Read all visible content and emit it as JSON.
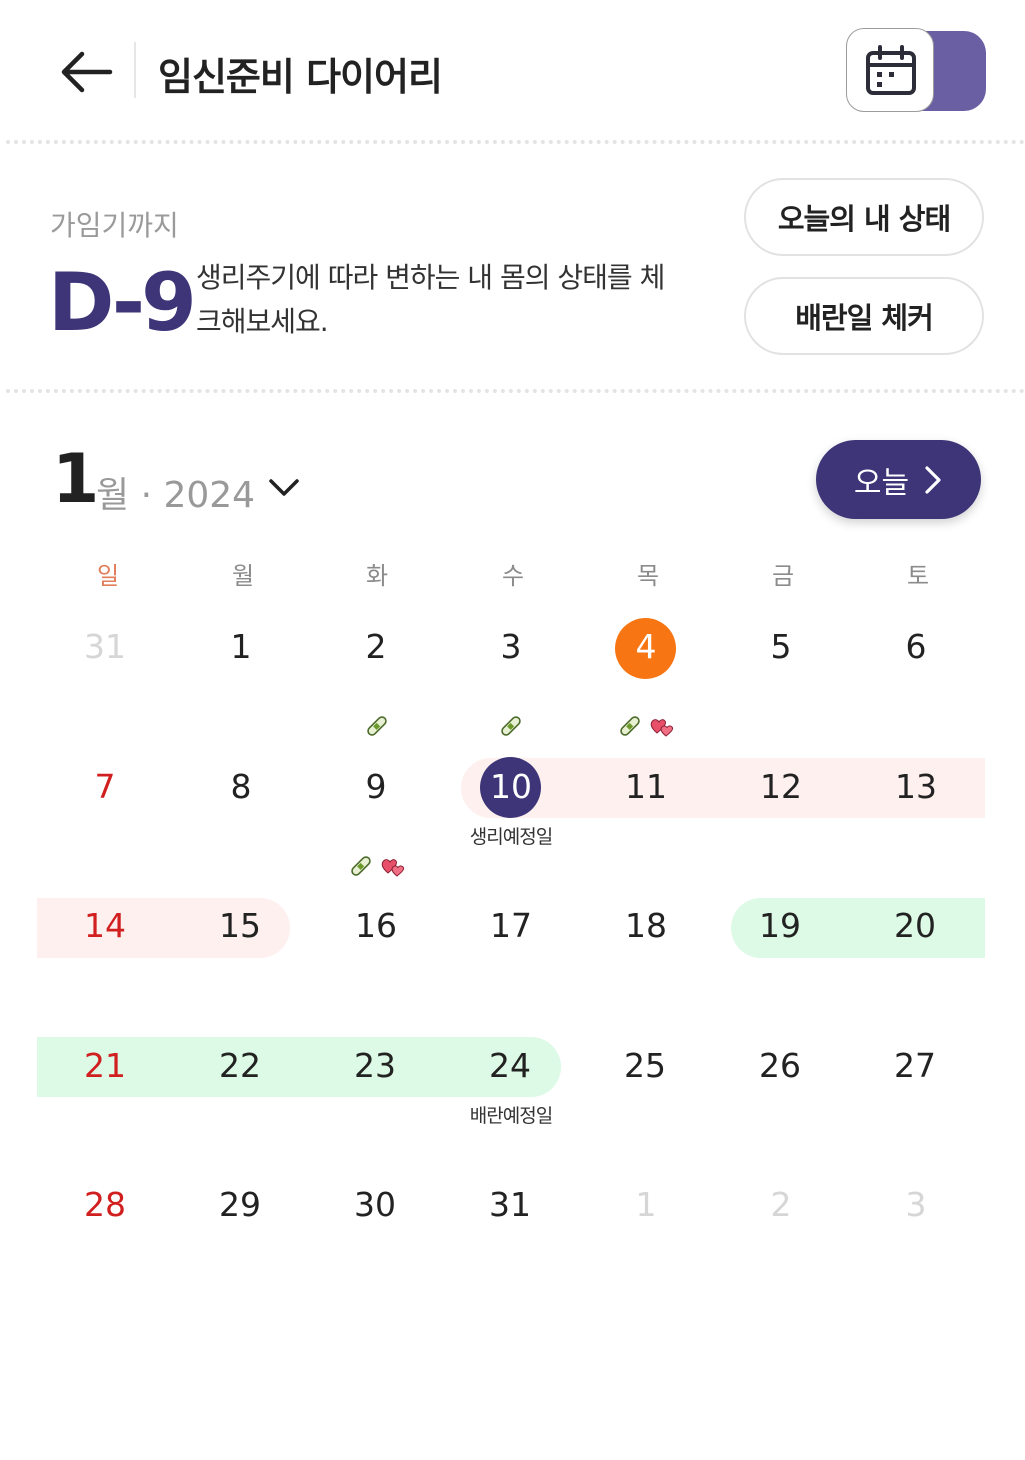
{
  "header": {
    "title": "임신준비 다이어리"
  },
  "dday": {
    "caption": "가임기까지",
    "value": "D-9",
    "description": "생리주기에 따라 변하는 내 몸의 상태를 체크해보세요."
  },
  "actions": {
    "today_status": "오늘의 내 상태",
    "ovulation_checker": "배란일 체커"
  },
  "calendar": {
    "month": "1",
    "month_suffix": "월 · 2024",
    "today_button": "오늘",
    "weekdays": [
      "일",
      "월",
      "화",
      "수",
      "목",
      "금",
      "토"
    ],
    "weeks": [
      [
        "31",
        "1",
        "2",
        "3",
        "4",
        "5",
        "6"
      ],
      [
        "7",
        "8",
        "9",
        "10",
        "11",
        "12",
        "13"
      ],
      [
        "14",
        "15",
        "16",
        "17",
        "18",
        "19",
        "20"
      ],
      [
        "21",
        "22",
        "23",
        "24",
        "25",
        "26",
        "27"
      ],
      [
        "28",
        "29",
        "30",
        "31",
        "1",
        "2",
        "3"
      ]
    ],
    "labels": {
      "period_expected": "생리예정일",
      "ovulation_expected": "배란예정일"
    }
  },
  "colors": {
    "brand": "#3d3578",
    "today": "#f77613",
    "period_band": "#fdf0ee",
    "fertile_band": "#dcfae5",
    "sunday": "#d11f1f"
  }
}
